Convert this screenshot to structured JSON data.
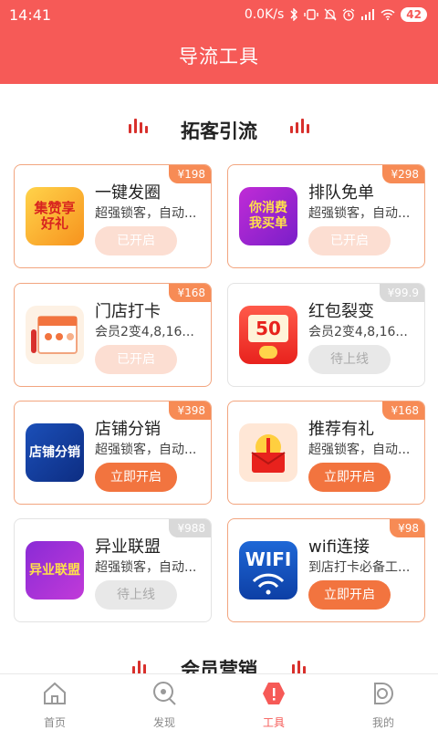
{
  "status": {
    "time": "14:41",
    "speed": "0.0K/s",
    "battery": "42"
  },
  "title": "导流工具",
  "sections": [
    {
      "title": "拓客引流"
    },
    {
      "title": "会员营销"
    }
  ],
  "cards": [
    {
      "name": "一键发圈",
      "desc": "超强锁客，自动...",
      "price": "¥198",
      "button": "已开启",
      "thumb": "集赞享好礼"
    },
    {
      "name": "排队免单",
      "desc": "超强锁客，自动...",
      "price": "¥298",
      "button": "已开启",
      "thumb": "你消费我买单"
    },
    {
      "name": "门店打卡",
      "desc": "会员2变4,8,16...",
      "price": "¥168",
      "button": "已开启",
      "thumb": ""
    },
    {
      "name": "红包裂变",
      "desc": "会员2变4,8,16...",
      "price": "¥99.9",
      "button": "待上线",
      "thumb": "50"
    },
    {
      "name": "店铺分销",
      "desc": "超强锁客，自动...",
      "price": "¥398",
      "button": "立即开启",
      "thumb": "店铺分销"
    },
    {
      "name": "推荐有礼",
      "desc": "超强锁客，自动...",
      "price": "¥168",
      "button": "立即开启",
      "thumb": ""
    },
    {
      "name": "异业联盟",
      "desc": "超强锁客，自动...",
      "price": "¥988",
      "button": "待上线",
      "thumb": "异业联盟"
    },
    {
      "name": "wifi连接",
      "desc": "到店打卡必备工...",
      "price": "¥98",
      "button": "立即开启",
      "thumb": "WIFI"
    }
  ],
  "tabs": [
    {
      "label": "首页"
    },
    {
      "label": "发现"
    },
    {
      "label": "工具"
    },
    {
      "label": "我的"
    }
  ],
  "colors": {
    "brand": "#f65a57",
    "accent": "#f2743f",
    "card_border": "#f2a57f"
  }
}
